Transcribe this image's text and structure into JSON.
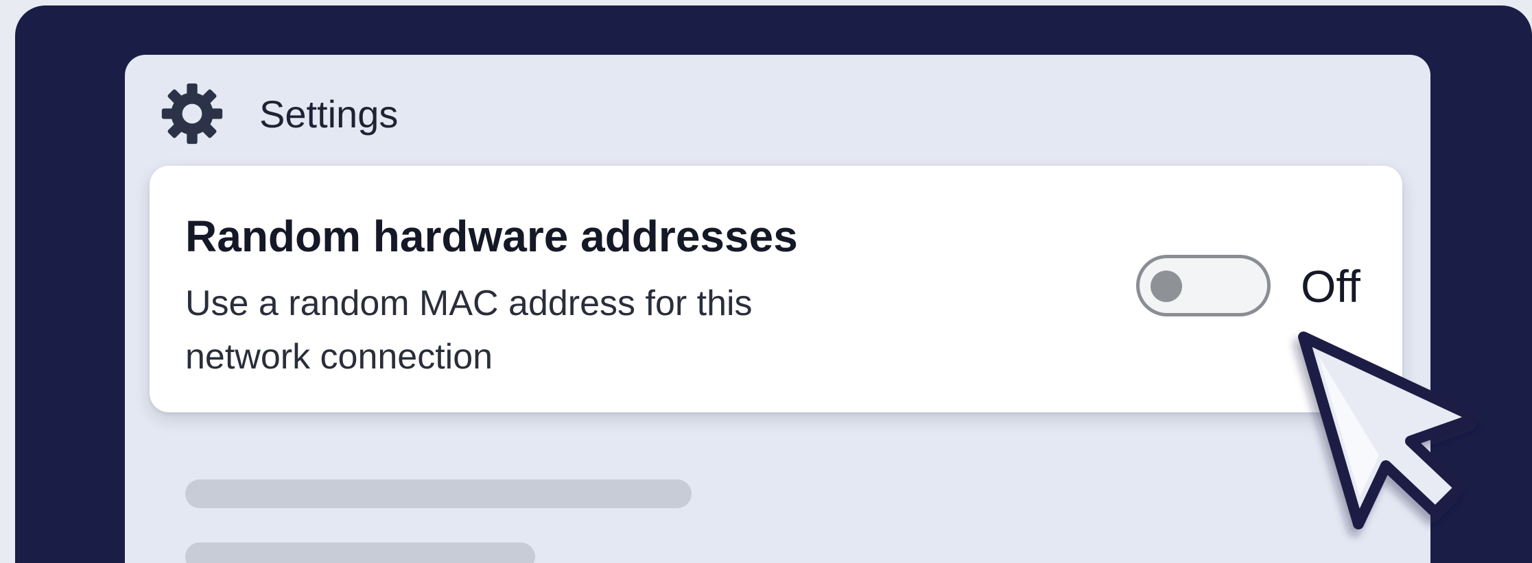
{
  "window": {
    "title": "Settings",
    "icon": "gear-icon"
  },
  "setting": {
    "title": "Random hardware addresses",
    "description": "Use a random MAC address for this network connection",
    "toggle": {
      "state": "off",
      "label": "Off"
    }
  },
  "colors": {
    "frame_background": "#1a1d45",
    "window_background": "#e4e8f2",
    "card_background": "#ffffff",
    "toggle_knob": "#8e9196",
    "toggle_border": "#8a8d94",
    "cursor_fill": "#e8ebf4",
    "cursor_outline": "#1a1d45"
  },
  "cursor": {
    "icon": "mouse-pointer-icon"
  }
}
